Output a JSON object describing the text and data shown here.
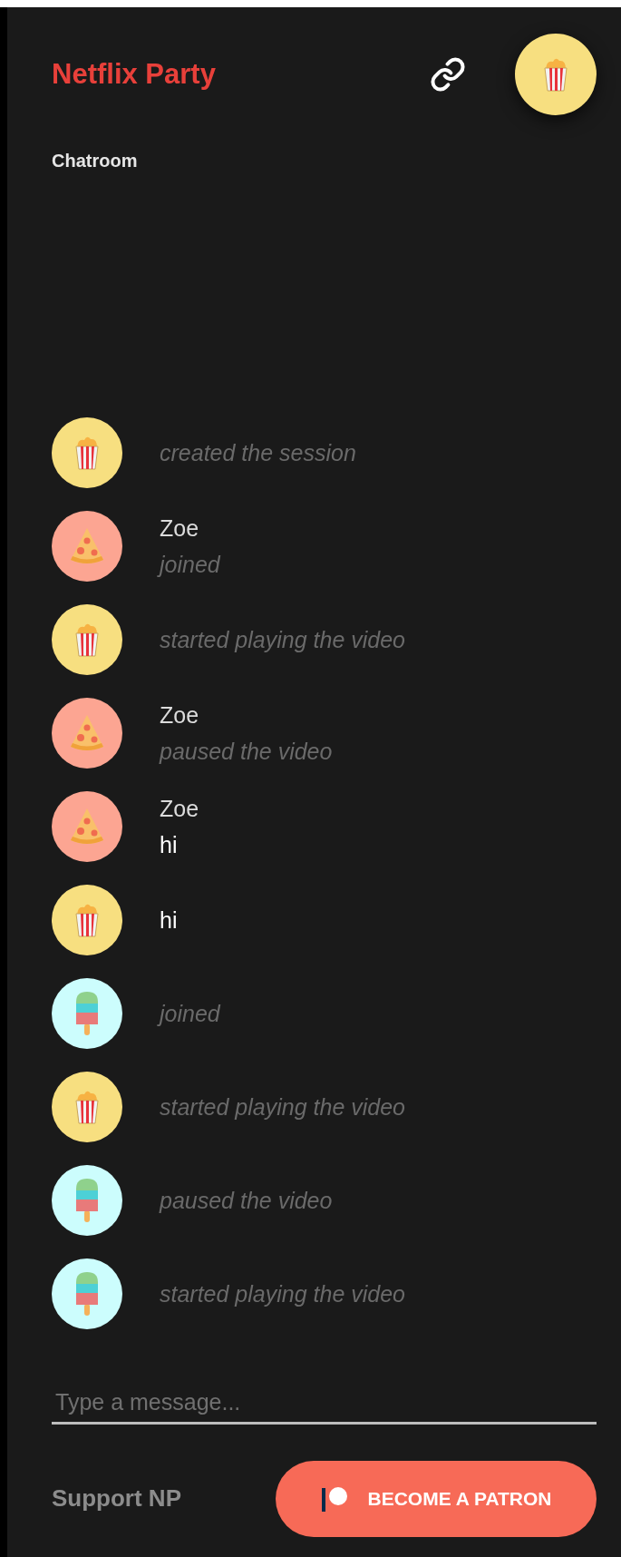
{
  "header": {
    "title": "Netflix Party",
    "avatar": {
      "kind": "popcorn"
    }
  },
  "section_title": "Chatroom",
  "messages": [
    {
      "avatar": {
        "kind": "popcorn"
      },
      "kind": "event",
      "text": "created the session"
    },
    {
      "avatar": {
        "kind": "pizza"
      },
      "kind": "event",
      "name": "Zoe",
      "text": "joined"
    },
    {
      "avatar": {
        "kind": "popcorn"
      },
      "kind": "event",
      "text": "started playing the video"
    },
    {
      "avatar": {
        "kind": "pizza"
      },
      "kind": "event",
      "name": "Zoe",
      "text": "paused the video"
    },
    {
      "avatar": {
        "kind": "pizza"
      },
      "kind": "message",
      "name": "Zoe",
      "text": "hi"
    },
    {
      "avatar": {
        "kind": "popcorn"
      },
      "kind": "message",
      "text": "hi"
    },
    {
      "avatar": {
        "kind": "popsicle"
      },
      "kind": "event",
      "text": "joined"
    },
    {
      "avatar": {
        "kind": "popcorn"
      },
      "kind": "event",
      "text": "started playing the video"
    },
    {
      "avatar": {
        "kind": "popsicle"
      },
      "kind": "event",
      "text": "paused the video"
    },
    {
      "avatar": {
        "kind": "popsicle"
      },
      "kind": "event",
      "text": "started playing the video"
    }
  ],
  "message_field": {
    "placeholder": "Type a message..."
  },
  "footer": {
    "label": "Support NP",
    "button": "BECOME A PATRON"
  }
}
